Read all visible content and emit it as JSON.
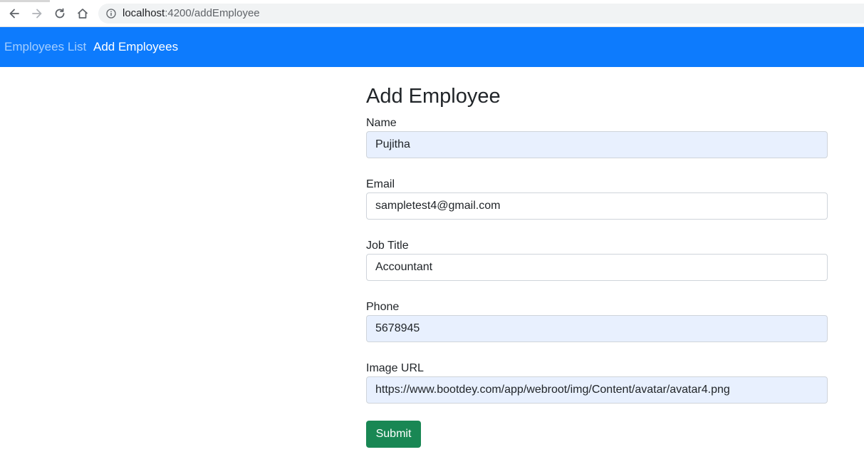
{
  "browser": {
    "url_host": "localhost",
    "url_path": ":4200/addEmployee",
    "icons": {
      "back": "arrow-left-icon",
      "forward": "arrow-right-icon",
      "reload": "reload-icon",
      "home": "home-icon",
      "info": "info-icon"
    }
  },
  "navbar": {
    "color": "#0d7bfd",
    "links": [
      {
        "label": "Employees List",
        "active": false
      },
      {
        "label": "Add Employees",
        "active": true
      }
    ]
  },
  "form": {
    "title": "Add Employee",
    "fields": [
      {
        "label": "Name",
        "value": "Pujitha",
        "autofilled": true
      },
      {
        "label": "Email",
        "value": "sampletest4@gmail.com",
        "autofilled": false
      },
      {
        "label": "Job Title",
        "value": "Accountant",
        "autofilled": false
      },
      {
        "label": "Phone",
        "value": "5678945",
        "autofilled": true
      },
      {
        "label": "Image URL",
        "value": "https://www.bootdey.com/app/webroot/img/Content/avatar/avatar4.png",
        "autofilled": true
      }
    ],
    "submit_label": "Submit",
    "submit_color": "#198754"
  }
}
